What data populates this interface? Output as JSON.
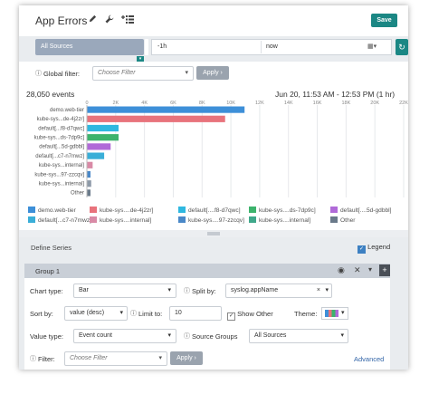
{
  "header": {
    "title": "App Errors",
    "save_label": "Save",
    "edit_icon": "pencil-icon",
    "tools_icon": "wrench-icon",
    "add_list_icon": "add-list-icon"
  },
  "query": {
    "sources_label": "All Sources",
    "from": "-1h",
    "to": "now",
    "calendar_icon": "calendar-icon",
    "refresh_icon": "refresh-icon"
  },
  "filter": {
    "label": "Global filter:",
    "placeholder": "Choose Filter",
    "apply": "Apply"
  },
  "summary": {
    "events": "28,050 events",
    "range": "Jun 20, 11:53 AM - 12:53 PM (1 hr)"
  },
  "chart_data": {
    "type": "bar",
    "orientation": "horizontal",
    "categories": [
      "demo.web-tier",
      "kube-sys...de-4j2zr]",
      "default[...f8-d7qwc]",
      "kube-sys...ds-7dp9c]",
      "default[...5d-gdbbl]",
      "default[...c7-n7mwz]",
      "kube-sys...internal]",
      "kube-sys...97-zzcqv]",
      "kube-sys...internal]",
      "Other"
    ],
    "values": [
      10950,
      9600,
      2200,
      2200,
      1650,
      1200,
      400,
      250,
      300,
      250
    ],
    "colors": [
      "#3d8fd8",
      "#e8737c",
      "#2fb8e0",
      "#3db36c",
      "#b06ad8",
      "#3aaed8",
      "#d98aa6",
      "#4a88c8",
      "#8e9aa8",
      "#6a7a8a"
    ],
    "xticks": [
      "0",
      "2K",
      "4K",
      "6K",
      "8K",
      "10K",
      "12K",
      "14K",
      "16K",
      "18K",
      "20K",
      "22K"
    ],
    "xlim": [
      0,
      22000
    ],
    "grid": true
  },
  "legend": [
    {
      "label": "demo.web-tier",
      "color": "#3d8fd8"
    },
    {
      "label": "kube-sys....de-4j2zr]",
      "color": "#e8737c"
    },
    {
      "label": "default[....f8-d7qwc]",
      "color": "#2fb8e0"
    },
    {
      "label": "kube-sys....ds-7dp9c]",
      "color": "#3db36c"
    },
    {
      "label": "default[....5d-gdbbl]",
      "color": "#b06ad8"
    },
    {
      "label": "default[...c7-n7mwz]",
      "color": "#3aaed8"
    },
    {
      "label": "kube-sys....internal]",
      "color": "#d98aa6"
    },
    {
      "label": "kube-sys....97-zzcqv]",
      "color": "#4a88c8"
    },
    {
      "label": "kube-sys....internal]",
      "color": "#3fa88a"
    },
    {
      "label": "Other",
      "color": "#6a7a8a"
    }
  ],
  "define": {
    "title": "Define Series",
    "legend_label": "Legend",
    "legend_checked": true
  },
  "group": {
    "name": "Group 1",
    "eye_icon": "eye-icon",
    "close_icon": "close-icon",
    "caret_icon": "caret-down-icon",
    "add_icon": "plus-icon"
  },
  "form": {
    "chart_type_label": "Chart type:",
    "chart_type": "Bar",
    "split_label": "Split by:",
    "split_value": "syslog.appName",
    "sort_label": "Sort by:",
    "sort_value": "value (desc)",
    "limit_label": "Limit to:",
    "limit_value": "10",
    "show_other_label": "Show Other",
    "theme_label": "Theme:",
    "value_type_label": "Value type:",
    "value_type": "Event count",
    "source_groups_label": "Source Groups",
    "source_groups_value": "All Sources",
    "filter_label": "Filter:",
    "filter_placeholder": "Choose Filter",
    "apply": "Apply",
    "advanced": "Advanced"
  }
}
